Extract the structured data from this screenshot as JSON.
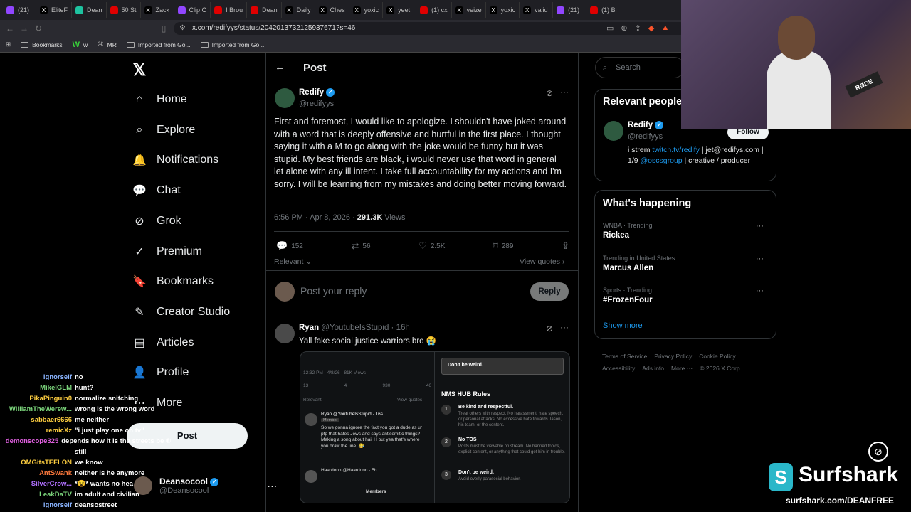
{
  "browser": {
    "tabs": [
      {
        "label": "(21)",
        "color": "#9146ff",
        "icon": "twitch-icon"
      },
      {
        "label": "EliteF",
        "color": "#000000",
        "icon": "x-icon"
      },
      {
        "label": "Dean",
        "color": "#1ec3a0",
        "icon": "app-icon"
      },
      {
        "label": "50 St",
        "color": "#e00000",
        "icon": "youtube-icon"
      },
      {
        "label": "Zack",
        "color": "#000000",
        "icon": "x-icon"
      },
      {
        "label": "Clip C",
        "color": "#9146ff",
        "icon": "twitch-icon"
      },
      {
        "label": "I Brou",
        "color": "#e00000",
        "icon": "youtube-icon"
      },
      {
        "label": "Dean",
        "color": "#e00000",
        "icon": "youtube-icon"
      },
      {
        "label": "Daily",
        "color": "#000000",
        "icon": "x-icon"
      },
      {
        "label": "Ches",
        "color": "#000000",
        "icon": "x-icon"
      },
      {
        "label": "yoxic",
        "color": "#000000",
        "icon": "x-icon"
      },
      {
        "label": "yeet",
        "color": "#000000",
        "icon": "x-icon"
      },
      {
        "label": "(1) cx",
        "color": "#e00000",
        "icon": "youtube-icon"
      },
      {
        "label": "veize",
        "color": "#000000",
        "icon": "x-icon"
      },
      {
        "label": "yoxic",
        "color": "#000000",
        "icon": "x-icon"
      },
      {
        "label": "valid",
        "color": "#000000",
        "icon": "x-icon"
      },
      {
        "label": "(21)",
        "color": "#9146ff",
        "icon": "twitch-icon"
      },
      {
        "label": "(1) Bi",
        "color": "#e00000",
        "icon": "youtube-icon"
      }
    ],
    "url": "x.com/redifyys/status/2042013732125937671?s=46",
    "bookmarks": [
      "Bookmarks",
      "w",
      "MR",
      "Imported from Go...",
      "Imported from Go..."
    ]
  },
  "nav": {
    "items": [
      "Home",
      "Explore",
      "Notifications",
      "Chat",
      "Grok",
      "Premium",
      "Bookmarks",
      "Creator Studio",
      "Articles",
      "Profile",
      "More"
    ],
    "post_label": "Post",
    "user_name": "Deansocool",
    "user_handle": "@Deansocool"
  },
  "post": {
    "header": "Post",
    "author": "Redify",
    "handle": "@redifyys",
    "body": "First and foremost, I would like to apologize. I shouldn't have joked around with a word that is deeply offensive and hurtful in the first place. I thought saying it with a M to go along with the joke would be funny but it was stupid. My best friends are black, i would never use that word in general let alone with any ill intent. I take full accountability for my actions and I'm sorry. I will be learning from my mistakes and doing better moving forward.",
    "time": "6:56 PM · Apr 8, 2026 · ",
    "views": "291.3K",
    "views_label": " Views",
    "replies": "152",
    "reposts": "56",
    "likes": "2.5K",
    "bookmarks": "289",
    "relevant": "Relevant",
    "view_quotes": "View quotes",
    "reply_placeholder": "Post your reply",
    "reply_button": "Reply"
  },
  "reply": {
    "author": "Ryan",
    "handle": "@YoutubeIsStupid · 16h",
    "body": "Yall fake social justice warriors bro 😭",
    "embed": {
      "time": "12:32 PM · 4/8/26 · 81K Views",
      "counts": [
        "13",
        "4",
        "930",
        "46"
      ],
      "relevant": "Relevant",
      "view_quotes": "View quotes",
      "inner_author": "Ryan @YoutubeIsStupid · 16s",
      "member": "Member",
      "inner_body": "So we gonna ignore the fact you got a dude as ur pfp that hates Jews and says antisemitic things? Making a song about hail H but yea that's where you draw the line. 😂",
      "inner_author2": "Haardonn @Haardonn · 5h",
      "members": "Members",
      "dont_weird": "Don't be weird.",
      "rules_title": "NMS HUB Rules",
      "rules": [
        {
          "num": "1",
          "title": "Be kind and respectful.",
          "desc": "Treat others with respect. No harassment, hate speech, or personal attacks. No excessive hate towards Jason, his team, or the content."
        },
        {
          "num": "2",
          "title": "No TOS",
          "desc": "Posts must be viewable on stream. No banned topics, explicit content, or anything that could get him in trouble."
        },
        {
          "num": "3",
          "title": "Don't be weird.",
          "desc": "Avoid overly parasocial behavior."
        }
      ]
    }
  },
  "right": {
    "search_placeholder": "Search",
    "relevant_title": "Relevant people",
    "person_name": "Redify",
    "person_handle": "@redifyys",
    "follow": "Follow",
    "bio_1": "i strem ",
    "bio_link": "twitch.tv/redify",
    "bio_2": " | jet@redifys.com | 1/9 ",
    "bio_link2": "@oscsgroup",
    "bio_3": " | creative / producer",
    "happening_title": "What's happening",
    "trends": [
      {
        "context": "WNBA · Trending",
        "name": "Rickea"
      },
      {
        "context": "Trending in United States",
        "name": "Marcus Allen"
      },
      {
        "context": "Sports · Trending",
        "name": "#FrozenFour"
      }
    ],
    "show_more": "Show more",
    "footer": [
      "Terms of Service",
      "Privacy Policy",
      "Cookie Policy",
      "Accessibility",
      "Ads info",
      "More ···",
      "© 2026 X Corp."
    ]
  },
  "chat": [
    {
      "user": "ignorself",
      "msg": "no",
      "color": "#8ab4ff"
    },
    {
      "user": "MikeIGLM",
      "msg": "hunt?",
      "color": "#7cd67c"
    },
    {
      "user": "PikaPinguin0",
      "msg": "normalize snitching",
      "color": "#ffcf40"
    },
    {
      "user": "WilliamTheWerew...",
      "msg": "wrong is the wrong word",
      "color": "#7cd67c"
    },
    {
      "user": "sabbaer6666",
      "msg": "me neither",
      "color": "#ffcf40"
    },
    {
      "user": "remicXz",
      "msg": "\"i just play one on tv\"",
      "color": "#ffcf40"
    },
    {
      "user": "demonscope325",
      "msg": "depends how it is the streets be ®",
      "color": "#e060e0"
    },
    {
      "user": "",
      "msg": "still",
      "color": "#ffffff"
    },
    {
      "user": "OMGitsTEFLON",
      "msg": "we know",
      "color": "#ffcf40"
    },
    {
      "user": "AntSwank",
      "msg": "neither is he anymore",
      "color": "#ff7a3d"
    },
    {
      "user": "SilverCrow...",
      "msg": "*😵* wants no hea",
      "color": "#b070ff"
    },
    {
      "user": "LeakDaTV",
      "msg": "im adult and civilian",
      "color": "#7cd67c"
    },
    {
      "user": "ignorself",
      "msg": "deansostreet",
      "color": "#8ab4ff"
    }
  ],
  "overlay": {
    "brand": "Surfshark",
    "url": "surfshark.com/DEANFREE",
    "rode": "RØDE",
    "accent": "#1d9bf0"
  }
}
